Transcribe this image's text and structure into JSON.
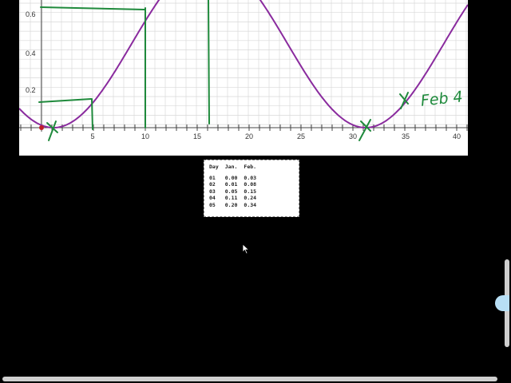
{
  "graph": {
    "y_ticks": [
      "0.6",
      "0.4",
      "0.2"
    ],
    "x_ticks": [
      "5",
      "10",
      "15",
      "20",
      "25",
      "30",
      "35",
      "40"
    ],
    "annotation": "Feb 4",
    "colors": {
      "curve": "#8a2b9e",
      "ink": "#1f8a3c",
      "grid": "#d9d9d9",
      "axis": "#444444",
      "point": "#c0202a"
    }
  },
  "data_table": {
    "headers": [
      "Day",
      "Jan.",
      "Feb."
    ],
    "rows": [
      [
        "01",
        "0.00",
        "0.03"
      ],
      [
        "02",
        "0.01",
        "0.08"
      ],
      [
        "03",
        "0.05",
        "0.15"
      ],
      [
        "04",
        "0.11",
        "0.24"
      ],
      [
        "05",
        "0.20",
        "0.34"
      ]
    ]
  },
  "icons": {
    "cursor": "arrow-cursor-icon",
    "side_handle": "expand-handle-icon"
  }
}
